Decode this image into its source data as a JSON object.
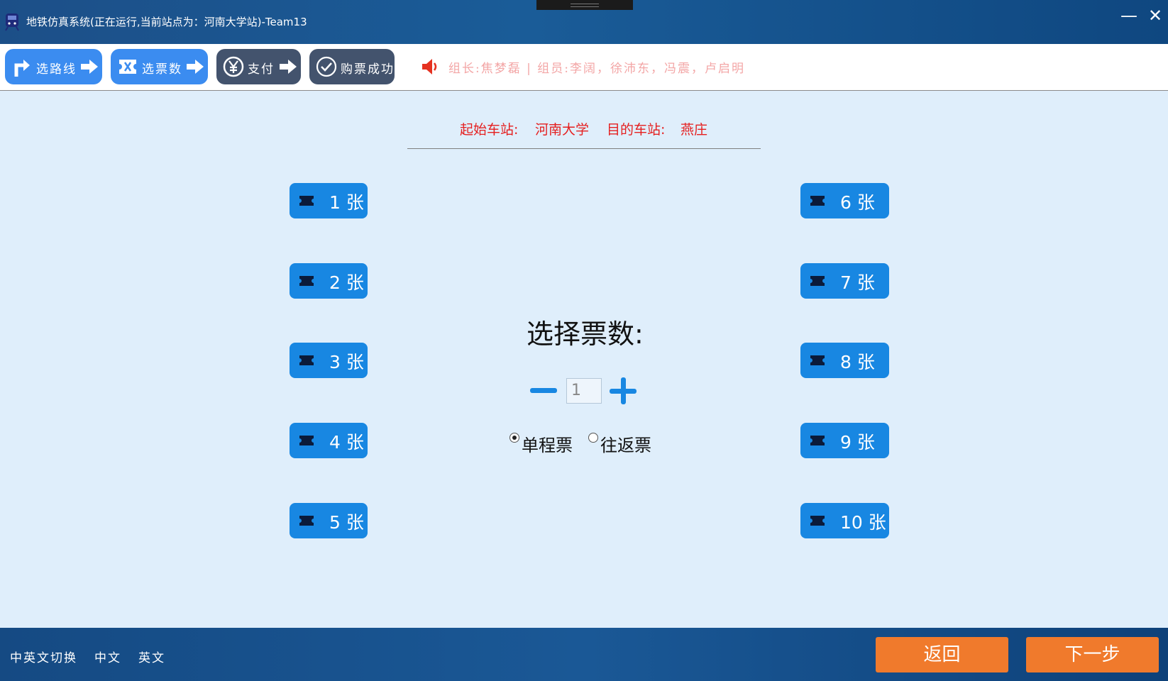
{
  "window": {
    "title": "地铁仿真系统(正在运行,当前站点为：河南大学站)-Team13",
    "minimize_glyph": "—",
    "close_glyph": "✕"
  },
  "steps": [
    {
      "label": "选路线",
      "icon": "turn-right-icon",
      "state": "active"
    },
    {
      "label": "选票数",
      "icon": "ticket-icon",
      "state": "active"
    },
    {
      "label": "支付",
      "icon": "yuan-icon",
      "state": "inactive"
    },
    {
      "label": "购票成功",
      "icon": "check-circle-icon",
      "state": "inactive"
    }
  ],
  "team": {
    "members": "组长:焦梦磊 | 组员:李阔，徐沛东，冯震，卢启明"
  },
  "route": {
    "origin_label": "起始车站:",
    "origin": "河南大学",
    "dest_label": "目的车站:",
    "dest": "燕庄"
  },
  "tickets": {
    "left": [
      "1 张",
      "2 张",
      "3 张",
      "4 张",
      "5 张"
    ],
    "right": [
      "6 张",
      "7 张",
      "8 张",
      "9 张",
      "10 张"
    ]
  },
  "selector": {
    "prompt": "选择票数:",
    "quantity": "1",
    "options": [
      {
        "label": "单程票",
        "checked": true
      },
      {
        "label": "往返票",
        "checked": false
      }
    ]
  },
  "footer": {
    "lang_toggle": "中英文切换",
    "lang_zh": "中文",
    "lang_en": "英文",
    "back": "返回",
    "next": "下一步"
  },
  "colors": {
    "accent_blue": "#1887e2",
    "step_active": "#3b8cf0",
    "step_inactive": "#43536d",
    "route_text": "#e51f1f",
    "footer_button": "#f07a2c"
  }
}
